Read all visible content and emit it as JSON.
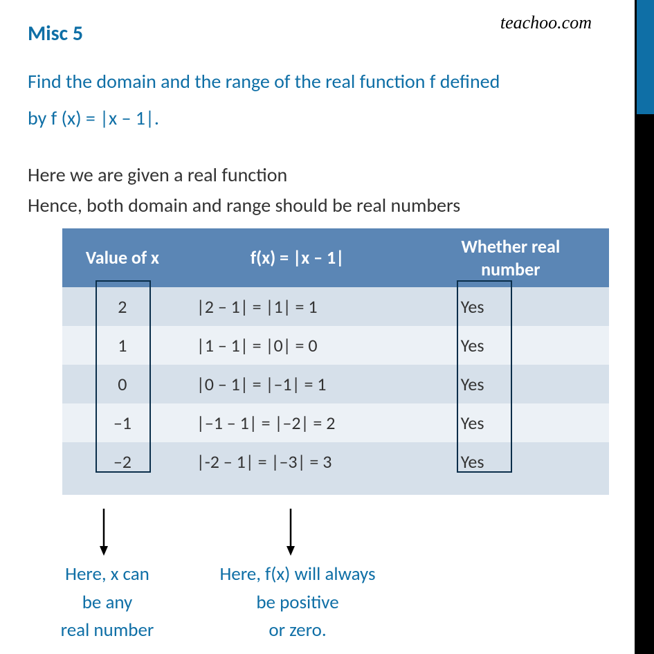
{
  "watermark": "teachoo.com",
  "title": "Misc  5",
  "question_line1": "Find the domain and the range of the real function f defined",
  "question_line2": "by f (x) = |x – 1|.",
  "intro_line1": "Here we are given a real function",
  "intro_line2": "Hence, both domain and range should be real numbers",
  "headers": {
    "h1": "Value of x",
    "h2": "f(x) = |x – 1|",
    "h3_a": "Whether real",
    "h3_b": "number"
  },
  "rows": [
    {
      "x": "2",
      "fx": "|2 – 1| = |1| = 1",
      "r": "Yes"
    },
    {
      "x": "1",
      "fx": "|1 – 1| = |0| = 0",
      "r": "Yes"
    },
    {
      "x": "0",
      "fx": "|0 – 1| = |–1| = 1",
      "r": "Yes"
    },
    {
      "x": "–1",
      "fx": "|–1 – 1| = |–2| = 2",
      "r": "Yes"
    },
    {
      "x": "–2",
      "fx": "|-2 – 1| = |–3| = 3",
      "r": "Yes"
    }
  ],
  "anno1_l1": "Here, x can",
  "anno1_l2": "be any",
  "anno1_l3": "real number",
  "anno2_l1": "Here, f(x) will always",
  "anno2_l2": "be positive",
  "anno2_l3": "or zero."
}
